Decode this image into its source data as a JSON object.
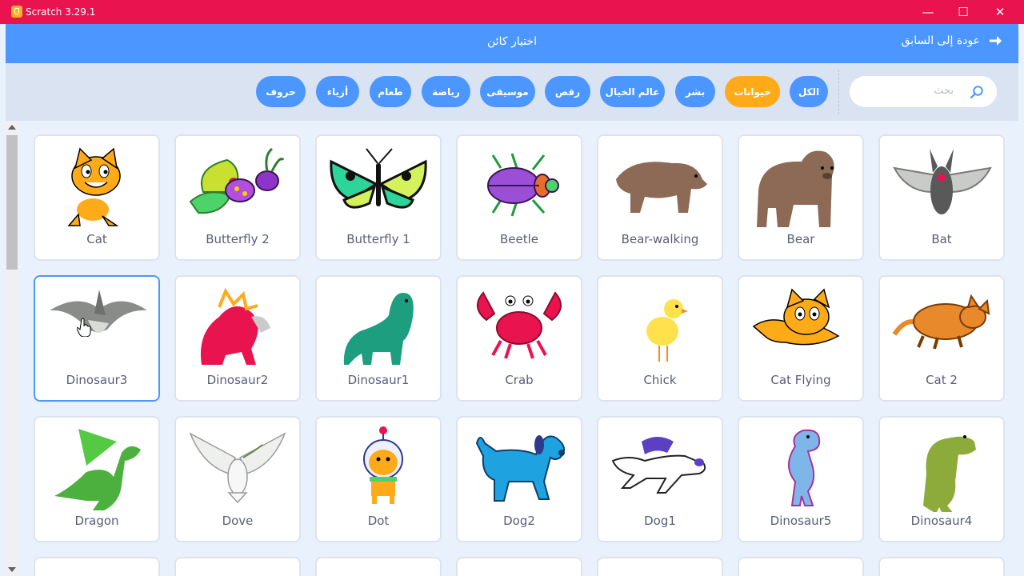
{
  "window": {
    "title": "Scratch 3.29.1",
    "controls": {
      "minimize": "—",
      "maximize": "☐",
      "close": "✕"
    }
  },
  "header": {
    "title": "اختيار كائن",
    "back_label": "عودة إلى السابق"
  },
  "search": {
    "placeholder": "بحث",
    "value": ""
  },
  "tags": [
    {
      "label": "الكل",
      "active": false
    },
    {
      "label": "حيوانات",
      "active": true
    },
    {
      "label": "بشر",
      "active": false
    },
    {
      "label": "عالم الخيال",
      "active": false
    },
    {
      "label": "رقص",
      "active": false
    },
    {
      "label": "موسيقى",
      "active": false
    },
    {
      "label": "رياضة",
      "active": false
    },
    {
      "label": "طعام",
      "active": false
    },
    {
      "label": "أزياء",
      "active": false
    },
    {
      "label": "حروف",
      "active": false
    }
  ],
  "sprites": [
    {
      "name": "Cat",
      "icon": "cat-sprite"
    },
    {
      "name": "Butterfly 2",
      "icon": "butterfly-2-sprite"
    },
    {
      "name": "Butterfly 1",
      "icon": "butterfly-1-sprite"
    },
    {
      "name": "Beetle",
      "icon": "beetle-sprite"
    },
    {
      "name": "Bear-walking",
      "icon": "bear-walking-sprite"
    },
    {
      "name": "Bear",
      "icon": "bear-sprite"
    },
    {
      "name": "Bat",
      "icon": "bat-sprite"
    },
    {
      "name": "Dinosaur3",
      "icon": "dinosaur3-sprite",
      "selected": true
    },
    {
      "name": "Dinosaur2",
      "icon": "dinosaur2-sprite"
    },
    {
      "name": "Dinosaur1",
      "icon": "dinosaur1-sprite"
    },
    {
      "name": "Crab",
      "icon": "crab-sprite"
    },
    {
      "name": "Chick",
      "icon": "chick-sprite"
    },
    {
      "name": "Cat Flying",
      "icon": "cat-flying-sprite"
    },
    {
      "name": "Cat 2",
      "icon": "cat-2-sprite"
    },
    {
      "name": "Dragon",
      "icon": "dragon-sprite"
    },
    {
      "name": "Dove",
      "icon": "dove-sprite"
    },
    {
      "name": "Dot",
      "icon": "dot-sprite"
    },
    {
      "name": "Dog2",
      "icon": "dog2-sprite"
    },
    {
      "name": "Dog1",
      "icon": "dog1-sprite"
    },
    {
      "name": "Dinosaur5",
      "icon": "dinosaur5-sprite"
    },
    {
      "name": "Dinosaur4",
      "icon": "dinosaur4-sprite"
    }
  ],
  "colors": {
    "title_bar": "#e8134f",
    "header": "#4c97ff",
    "filter_bar": "#d9e3f2",
    "tag": "#4c97ff",
    "tag_active": "#ffab19",
    "selected_border": "#4c97ff"
  }
}
